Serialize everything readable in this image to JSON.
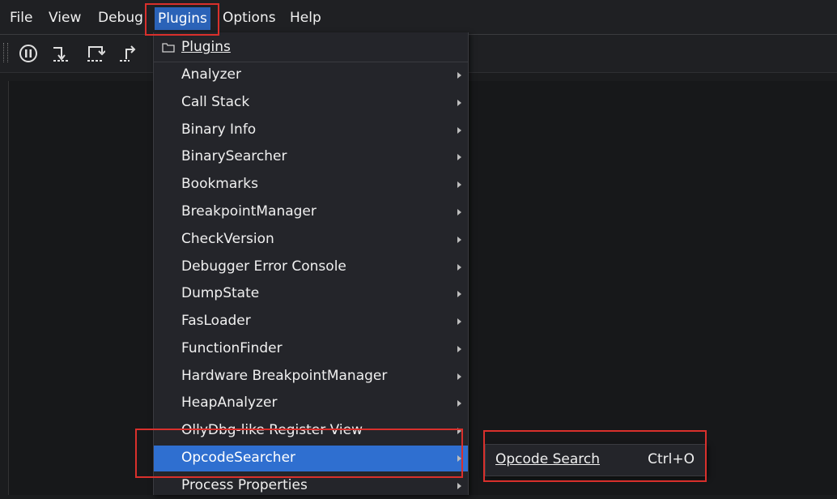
{
  "menubar": {
    "items": [
      {
        "label": "File"
      },
      {
        "label": "View"
      },
      {
        "label": "Debug"
      },
      {
        "label": "Plugins"
      },
      {
        "label": "Options"
      },
      {
        "label": "Help"
      }
    ]
  },
  "plugins_menu": {
    "header": "Plugins",
    "items": [
      {
        "label": "Analyzer"
      },
      {
        "label": "Call Stack"
      },
      {
        "label": "Binary Info"
      },
      {
        "label": "BinarySearcher"
      },
      {
        "label": "Bookmarks"
      },
      {
        "label": "BreakpointManager"
      },
      {
        "label": "CheckVersion"
      },
      {
        "label": "Debugger Error Console"
      },
      {
        "label": "DumpState"
      },
      {
        "label": "FasLoader"
      },
      {
        "label": "FunctionFinder"
      },
      {
        "label": "Hardware BreakpointManager"
      },
      {
        "label": "HeapAnalyzer"
      },
      {
        "label": "OllyDbg-like Register View"
      },
      {
        "label": "OpcodeSearcher"
      },
      {
        "label": "Process Properties"
      }
    ],
    "selected_index": 14
  },
  "submenu": {
    "item_label": "Opcode Search",
    "shortcut": "Ctrl+O"
  },
  "toolbar": {
    "icons": [
      "pause-icon",
      "step-into-icon",
      "step-over-icon",
      "step-out-icon"
    ]
  },
  "colors": {
    "accent": "#2f6fd0",
    "highlight_box": "#d9302c",
    "background": "#1b1c1e"
  }
}
